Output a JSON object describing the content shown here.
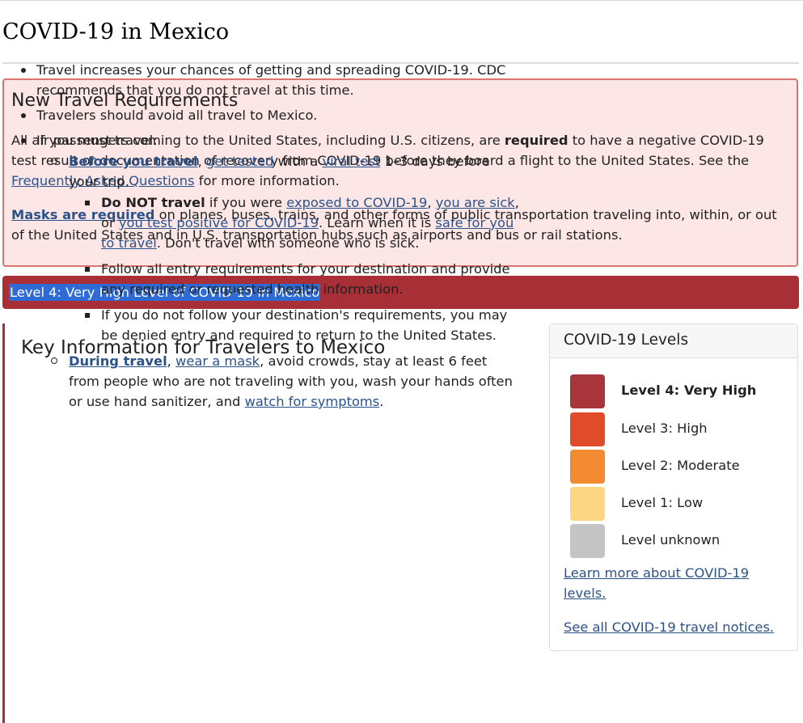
{
  "page_title": "COVID-19 in Mexico",
  "alert": {
    "heading": "New Travel Requirements",
    "p1_before_bold": "All air passengers coming to the United States, including U.S. citizens, are ",
    "p1_bold": "required",
    "p1_after_bold": " to have a negative COVID-19 test result or documentation of recovery from COVID-19 before they board a flight to the United States. See the ",
    "faq_link": "Frequently Asked Questions",
    "p1_end": " for more information.",
    "masks_link": "Masks are required",
    "p2_rest": " on planes, buses, trains, and other forms of public transportation traveling into, within, or out of the United States and in U.S. transportation hubs such as airports and bus or rail stations."
  },
  "level_banner": "Level 4: Very High Level of COVID-19 in Mexico",
  "key_info": {
    "heading": "Key Information for Travelers to Mexico",
    "b1": "Travel increases your chances of getting and spreading COVID-19. CDC recommends that you do not travel at this time.",
    "b2": "Travelers should avoid all travel to Mexico.",
    "b3": "If you must travel:",
    "before_link": "Before you travel",
    "comma1": ", ",
    "get_tested_link": "get tested",
    "with_a": " with a ",
    "viral_test_link": "viral test",
    "before_rest": " 1–3 days before your trip.",
    "do_not_bold": "Do NOT travel",
    "if_you_were": " if you were ",
    "exposed_link": "exposed to COVID-19",
    "comma2": ", ",
    "sick_link": "you are sick",
    "or": ", or ",
    "positive_link": "you test positive for COVID-19",
    "learn_when": ". Learn when it is ",
    "safe_link": "safe for you to travel",
    "dont_travel": ". Don't travel with someone who is sick.",
    "follow": "Follow all entry requirements for your destination and provide any required or requested health information.",
    "denied": "If you do not follow your destination's requirements, you may be denied entry and required to return to the United States.",
    "during_link": "During travel",
    "comma3": ", ",
    "mask_link": "wear a mask",
    "during_rest": ", avoid crowds, stay at least 6 feet from people who are not traveling with you, wash your hands often or use hand sanitizer, and ",
    "watch_link": "watch for symptoms",
    "during_end": "."
  },
  "levels": {
    "heading": "COVID-19 Levels",
    "items": [
      {
        "label": "Level 4: Very High",
        "color": "#a8353a",
        "bold": true
      },
      {
        "label": "Level 3: High",
        "color": "#e04b2a",
        "bold": false
      },
      {
        "label": "Level 2: Moderate",
        "color": "#f18a30",
        "bold": false
      },
      {
        "label": "Level 1: Low",
        "color": "#fdd684",
        "bold": false
      },
      {
        "label": "Level unknown",
        "color": "#c4c4c4",
        "bold": false
      }
    ],
    "learn_more": "Learn more about COVID-19 levels.",
    "see_all": "See all COVID-19 travel notices."
  }
}
